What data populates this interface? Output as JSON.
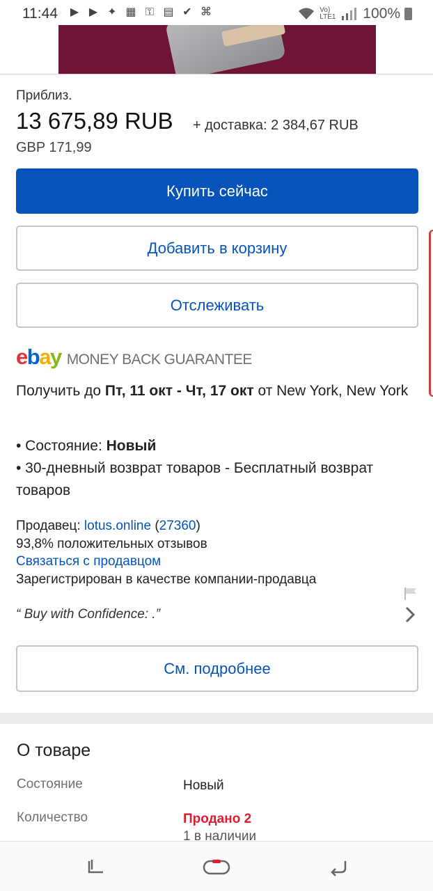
{
  "status_bar": {
    "time": "11:44",
    "network_label": "Vo) LTE1",
    "battery_text": "100%"
  },
  "product": {
    "approx_label": "Приблиз.",
    "price": "13 675,89 RUB",
    "shipping": "+ доставка: 2 384,67 RUB",
    "gbp_price": "GBP 171,99"
  },
  "actions": {
    "buy_now": "Купить сейчас",
    "add_to_cart": "Добавить в корзину",
    "watch": "Отслеживать"
  },
  "guarantee": {
    "logo_text": "ebay",
    "text": "MONEY BACK GUARANTEE"
  },
  "delivery": {
    "prefix": "Получить до ",
    "dates": "Пт, 11 окт - Чт, 17 окт",
    "suffix": " от New York, New York"
  },
  "facts": {
    "condition_prefix": "• Состояние: ",
    "condition_value": "Новый",
    "returns": "• 30-дневный возврат товаров - Бесплатный возврат товаров"
  },
  "seller": {
    "label": "Продавец: ",
    "name": "lotus.online",
    "feedback_open": " (",
    "feedback_count": "27360",
    "feedback_close": ")",
    "positive": "93,8% положительных отзывов",
    "contact": "Связаться с продавцом",
    "registered": "Зарегистрирован в качестве компании-продавца",
    "quote": "“  Buy with Confidence:  .”"
  },
  "see_more": "См. подробнее",
  "about": {
    "title": "О товаре",
    "rows": [
      {
        "label": "Состояние",
        "value": "Новый"
      },
      {
        "label": "Количество",
        "value": "Продано 2",
        "sub": "1 в наличии"
      }
    ]
  },
  "colors": {
    "primary": "#0654ba",
    "sold_red": "#dd1e31",
    "hero_bg": "#6e1437"
  }
}
